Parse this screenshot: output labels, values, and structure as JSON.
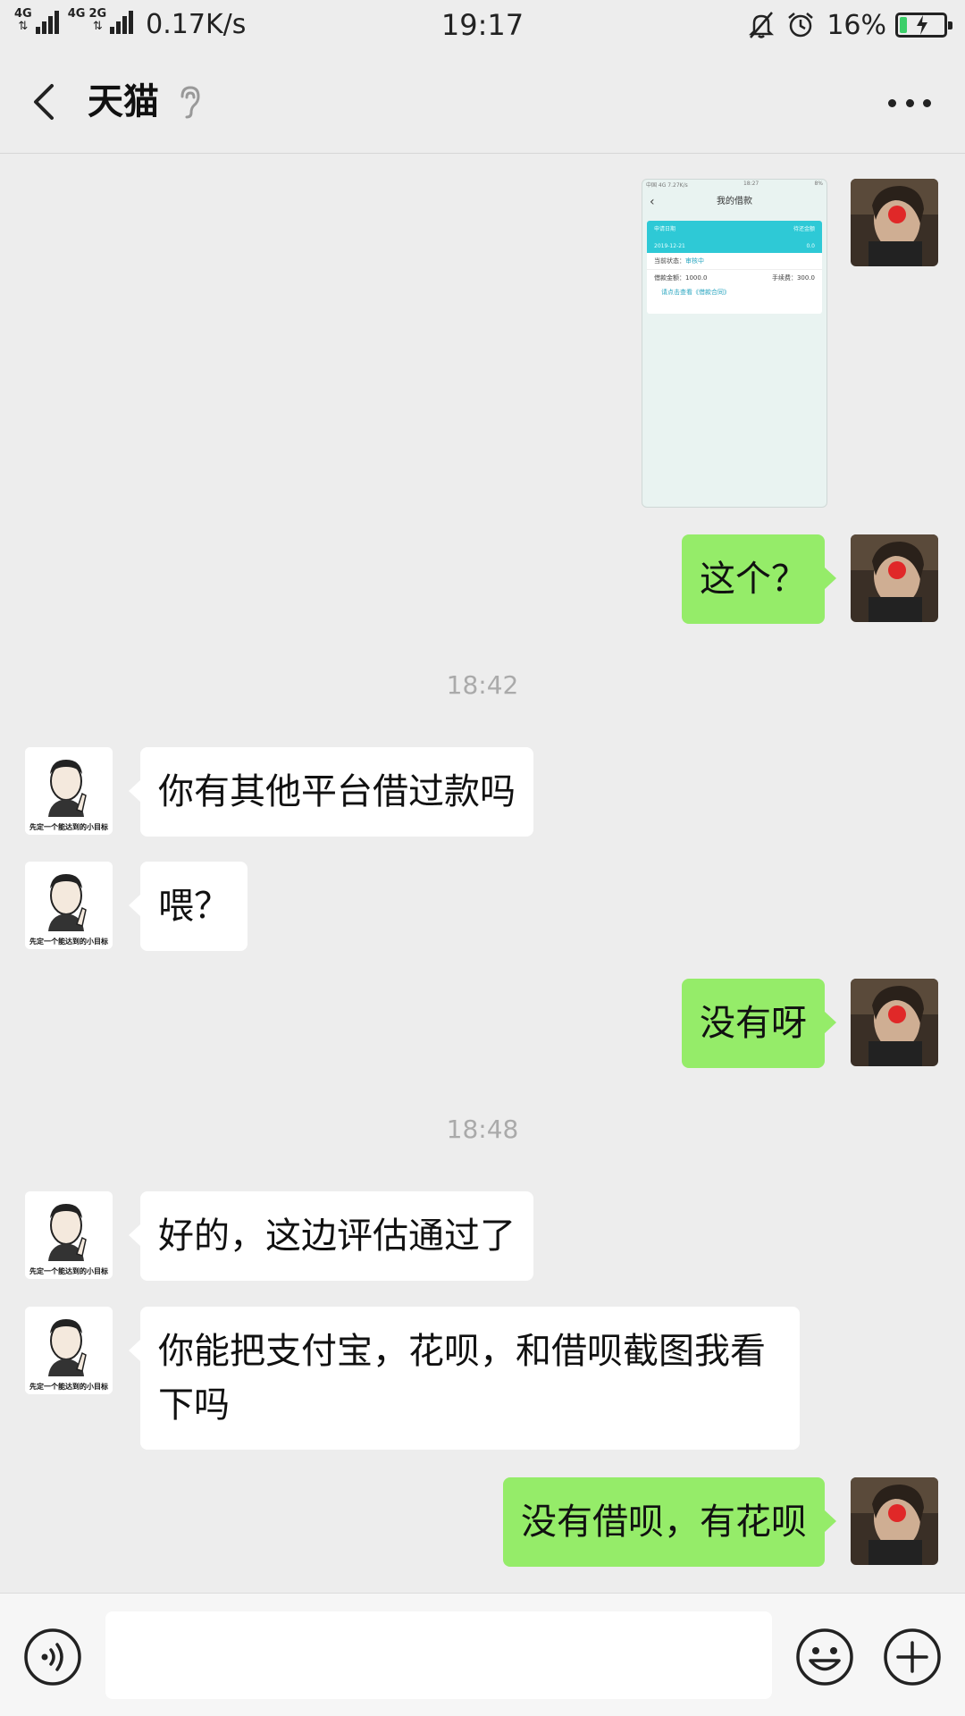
{
  "status_bar": {
    "network_1": "4G",
    "network_2": "4G",
    "network_3": "2G",
    "speed": "0.17K/s",
    "time": "19:17",
    "battery_percent": "16%",
    "battery_level": 0.16
  },
  "header": {
    "title": "天猫"
  },
  "image_message": {
    "mini_status_left": "中国 4G 7.27K/s",
    "mini_status_time": "18:27",
    "mini_status_right": "8%",
    "title": "我的借款",
    "bar_label_left": "申请日期",
    "bar_label_right": "待还金额",
    "bar_date": "2019-12-21",
    "bar_amount": "0.0",
    "status_label": "当前状态：",
    "status_value": "审核中",
    "loan_label": "借款金额：",
    "loan_value": "1000.0",
    "fee_label": "手续费：",
    "fee_value": "300.0",
    "contract_link": "请点击查看《借款合同》"
  },
  "messages": [
    {
      "from": "me",
      "text": "这个？"
    },
    {
      "timestamp": "18:42"
    },
    {
      "from": "them",
      "text": "你有其他平台借过款吗"
    },
    {
      "from": "them",
      "text": "喂？"
    },
    {
      "from": "me",
      "text": "没有呀"
    },
    {
      "timestamp": "18:48"
    },
    {
      "from": "them",
      "text": "好的，这边评估通过了"
    },
    {
      "from": "them",
      "text": "你能把支付宝，花呗，和借呗截图我看下吗"
    },
    {
      "from": "me",
      "text": "没有借呗，有花呗"
    }
  ],
  "avatar_caption": "先定一个能达到的小目标",
  "input": {
    "value": "",
    "placeholder": ""
  },
  "colors": {
    "my_bubble": "#95ec69",
    "their_bubble": "#ffffff",
    "background": "#ededed"
  }
}
